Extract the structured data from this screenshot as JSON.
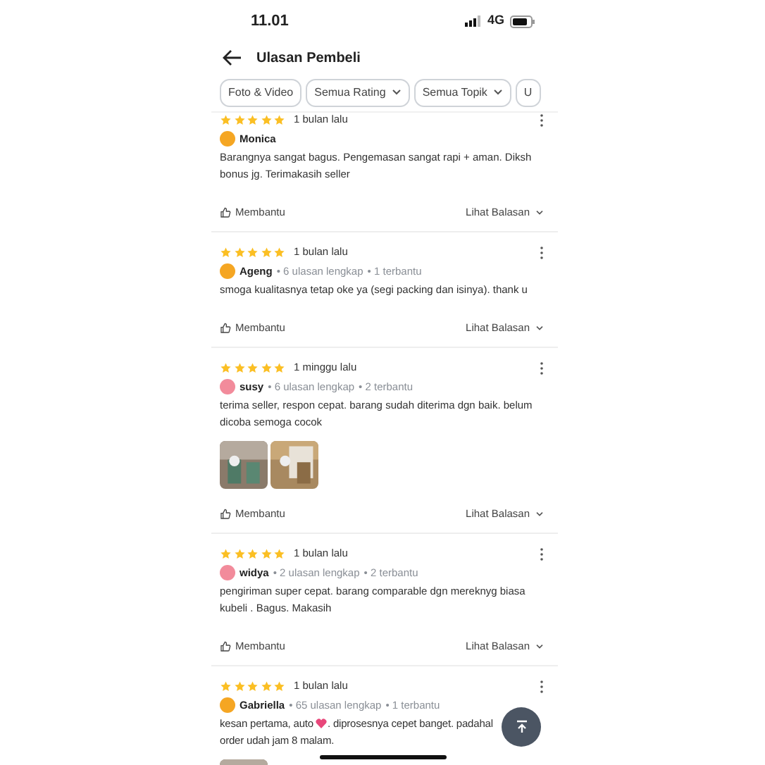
{
  "status_bar": {
    "time": "11.01",
    "network": "4G"
  },
  "header": {
    "title": "Ulasan Pembeli"
  },
  "filters": [
    {
      "label": "Foto & Video",
      "dropdown": false
    },
    {
      "label": "Semua Rating",
      "dropdown": true
    },
    {
      "label": "Semua Topik",
      "dropdown": true
    },
    {
      "label": "U",
      "dropdown": false
    }
  ],
  "reviews": [
    {
      "stars": 5,
      "time": "1 bulan lalu",
      "name": "Monica",
      "color": "#f5a623",
      "body": [
        "Barangnya sangat bagus. Pengemasan sangat rapi + aman. Diksh bonus jg. Terimakasih seller"
      ],
      "helpful": "Membantu",
      "replies": "Lihat Balasan"
    },
    {
      "stars": 5,
      "time": "1 bulan lalu",
      "name": "Ageng",
      "color": "#f5a623",
      "reviews_count": "• 6 ulasan lengkap",
      "helped": "• 1 terbantu",
      "body": [
        "smoga kualitasnya tetap oke ya (segi packing dan isinya). thank u"
      ],
      "helpful": "Membantu",
      "replies": "Lihat Balasan"
    },
    {
      "stars": 5,
      "time": "1 minggu lalu",
      "name": "susy",
      "color": "#f28b9b",
      "reviews_count": "• 6 ulasan lengkap",
      "helped": "• 2 terbantu",
      "body": [
        "terima seller, respon cepat. barang sudah diterima dgn baik. belum dicoba semoga cocok"
      ],
      "photos": [
        {
          "kind": "picture"
        },
        {
          "kind": "picture"
        }
      ],
      "helpful": "Membantu",
      "replies": "Lihat Balasan"
    },
    {
      "stars": 5,
      "time": "1 bulan lalu",
      "name": "widya",
      "color": "#f28b9b",
      "reviews_count": "• 2 ulasan lengkap",
      "helped": "• 2 terbantu",
      "body": [
        "pengiriman super cepat. barang comparable dgn mereknyg biasa kubeli . Bagus. Makasih"
      ],
      "helpful": "Membantu",
      "replies": "Lihat Balasan"
    },
    {
      "stars": 5,
      "time": "1 bulan lalu",
      "name": "Gabriella",
      "color": "#f5a623",
      "reviews_count": "• 65 ulasan lengkap",
      "helped": "• 1 terbantu",
      "body": [
        "kesan pertama, auto",
        ". diprosesnya cepet banget. padahal",
        "order udah jam 8 malam."
      ],
      "photos": [
        {
          "kind": "picture"
        }
      ]
    }
  ]
}
